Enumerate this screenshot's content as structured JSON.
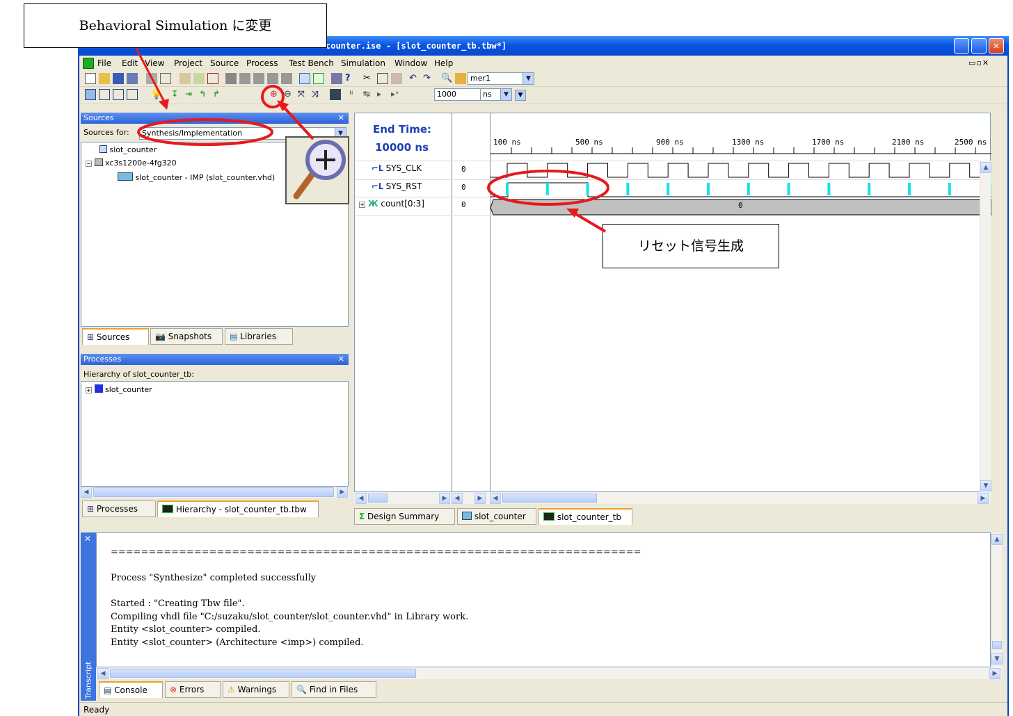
{
  "window": {
    "title": "counter.ise - [slot_counter_tb.tbw*]"
  },
  "menu": [
    "File",
    "Edit",
    "View",
    "Project",
    "Source",
    "Process",
    "Test Bench",
    "Simulation",
    "Window",
    "Help"
  ],
  "toolbar": {
    "find_value": "mer1",
    "time_value": "1000",
    "time_unit": "ns"
  },
  "sources": {
    "header": "Sources",
    "sources_for_label": "Sources for:",
    "sources_for_value": "Synthesis/Implementation",
    "tree": [
      "slot_counter",
      "xc3s1200e-4fg320",
      "slot_counter - IMP (slot_counter.vhd)"
    ],
    "tabs": [
      "Sources",
      "Snapshots",
      "Libraries"
    ]
  },
  "processes": {
    "header": "Processes",
    "hierarchy_label": "Hierarchy of slot_counter_tb:",
    "tree": [
      "slot_counter"
    ],
    "tabs": [
      "Processes",
      "Hierarchy - slot_counter_tb.tbw"
    ]
  },
  "waveform": {
    "end_time_label": "End Time:",
    "end_time_value": "10000 ns",
    "time_ticks": [
      "100 ns",
      "500 ns",
      "900 ns",
      "1300 ns",
      "1700 ns",
      "2100 ns",
      "2500 ns"
    ],
    "signals": [
      {
        "name": "SYS_CLK",
        "value": "0"
      },
      {
        "name": "SYS_RST",
        "value": "0"
      },
      {
        "name": "count[0:3]",
        "value": "0",
        "bus_value": "0"
      }
    ],
    "tabs": [
      "Design Summary",
      "slot_counter",
      "slot_counter_tb"
    ]
  },
  "console": {
    "lines": [
      "======================================================================",
      "",
      "Process \"Synthesize\" completed successfully",
      "",
      "Started : \"Creating Tbw file\".",
      "Compiling vhdl file \"C:/suzaku/slot_counter/slot_counter.vhd\" in Library work.",
      "Entity <slot_counter> compiled.",
      "Entity <slot_counter> (Architecture <imp>) compiled."
    ],
    "side_label": "Transcript",
    "tabs": [
      "Console",
      "Errors",
      "Warnings",
      "Find in Files"
    ]
  },
  "status": {
    "text": "Ready"
  },
  "annotations": {
    "behavioral": "Behavioral Simulation に変更",
    "reset": "リセット信号生成"
  },
  "colors": {
    "accent": "#0b55e0",
    "annotation_red": "#e8191c",
    "tick_cyan": "#19e0e6"
  }
}
